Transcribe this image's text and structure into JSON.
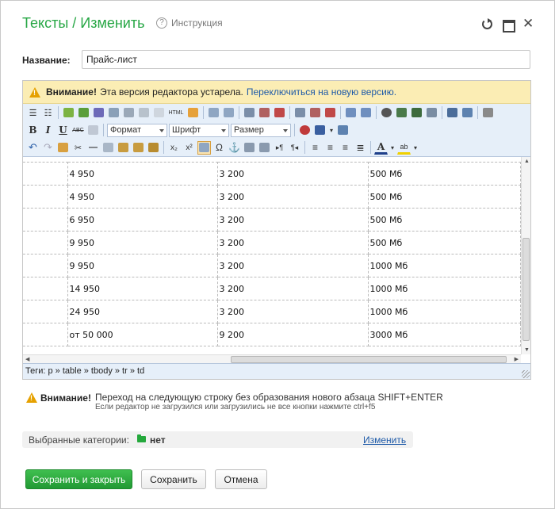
{
  "header": {
    "title": "Тексты / Изменить",
    "help_label": "Инструкция",
    "help_icon": "question-circle-icon"
  },
  "form": {
    "name_label": "Название:",
    "name_value": "Прайс-лист"
  },
  "editor": {
    "warning_bold": "Внимание!",
    "warning_text": "Эта версия редактора устарела.",
    "warning_link": "Переключиться на новую версию.",
    "toolbar": {
      "format_select": "Формат",
      "font_select": "Шрифт",
      "size_select": "Размер"
    },
    "table": {
      "rows": [
        [
          "",
          "4 950",
          "3 200",
          "500 Мб"
        ],
        [
          "",
          "4 950",
          "3 200",
          "500 Мб"
        ],
        [
          "",
          "6 950",
          "3 200",
          "500 Мб"
        ],
        [
          "",
          "9 950",
          "3 200",
          "500 Мб"
        ],
        [
          "",
          "9 950",
          "3 200",
          "1000 Мб"
        ],
        [
          "",
          "14 950",
          "3 200",
          "1000 Мб"
        ],
        [
          "",
          "24 950",
          "3 200",
          "1000 Мб"
        ],
        [
          "",
          "от 50 000",
          "9 200",
          "3000 Мб"
        ]
      ]
    },
    "path": "Теги: p » table » tbody » tr » td"
  },
  "notice": {
    "label": "Внимание!",
    "main": "Переход на следующую строку без образования нового абзаца SHIFT+ENTER",
    "sub": "Если редактор не загрузился или загрузились не все кнопки нажмите ctrl+f5"
  },
  "categories": {
    "label": "Выбранные категории:",
    "value": "нет",
    "change_link": "Изменить"
  },
  "buttons": {
    "save_close": "Сохранить и закрыть",
    "save": "Сохранить",
    "cancel": "Отмена"
  },
  "colors": {
    "accent": "#27a745",
    "link": "#1e5aa8",
    "warning_bg": "#fbedb4",
    "toolbar_bg": "#e6eff9"
  }
}
